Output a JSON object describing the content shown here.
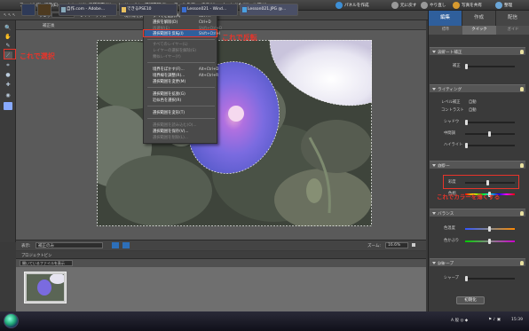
{
  "menubar": {
    "items": [
      "ファイル(F)",
      "編集(E)",
      "イメージ(I)",
      "画質調整(N)",
      "レイヤー(L)",
      "選択範囲(S)",
      "フィルタ(T)",
      "表示(V)",
      "ウィンドウ(W)",
      "ヘルプ(H)"
    ],
    "right_items": [
      "パネルを作成",
      "元に戻す",
      "やり直し",
      "写真を共有",
      "整理"
    ]
  },
  "options_bar": {
    "items": [
      "フェザー:",
      "レイヤーサイズ",
      "",
      "境界線を調整..."
    ]
  },
  "document": {
    "tab_title": "補正後"
  },
  "status": {
    "view_label": "表示:",
    "view_value": "補正のみ",
    "zoom_label": "ズーム:",
    "zoom_value": "16.6%"
  },
  "project_bin": {
    "header": "プロジェクトビン",
    "dropdown": "開いているファイルを表示"
  },
  "panel": {
    "tabs": [
      "編集",
      "作成",
      "配信"
    ],
    "subtabs": [
      "標準",
      "クイック",
      "ガイド"
    ],
    "sections": {
      "smart_fix": {
        "title": "スマート補正",
        "auto": "自動",
        "row": "補正"
      },
      "lighting": {
        "title": "ライティング",
        "rows": [
          "レベル補正",
          "コントラスト",
          "シャドウ",
          "中間調",
          "ハイライト"
        ],
        "autos": [
          "自動",
          "自動"
        ]
      },
      "color": {
        "title": "カラー",
        "auto": "自動",
        "rows": [
          "彩度",
          "色相"
        ]
      },
      "balance": {
        "title": "バランス",
        "rows": [
          "色温度",
          "色かぶり"
        ]
      },
      "sharpen": {
        "title": "シャープ",
        "auto": "自動",
        "row": "シャープ"
      }
    },
    "reset_button": "初期化"
  },
  "select_menu": {
    "items": [
      {
        "label": "すべてを選択(A)",
        "shortcut": "Ctrl+A",
        "enabled": true
      },
      {
        "label": "選択を解除(D)",
        "shortcut": "Ctrl+D",
        "enabled": true
      },
      {
        "label": "再選択(E)",
        "shortcut": "Shift+Ctrl+D",
        "enabled": false
      },
      {
        "label": "選択範囲を反転(I)",
        "shortcut": "Shift+Ctrl+I",
        "enabled": true,
        "highlight": true
      },
      {
        "label": "すべてのレイヤー(L)",
        "shortcut": "",
        "enabled": false
      },
      {
        "label": "レイヤーの選択を解除(S)",
        "shortcut": "",
        "enabled": false
      },
      {
        "label": "類似レイヤー(Y)",
        "shortcut": "",
        "enabled": false
      },
      {
        "label": "境界をぼかす(F)...",
        "shortcut": "Alt+Ctrl+D",
        "enabled": true
      },
      {
        "label": "境界線を調整(R)...",
        "shortcut": "Alt+Ctrl+R",
        "enabled": true
      },
      {
        "label": "選択範囲を変更(M)",
        "shortcut": "",
        "enabled": true
      },
      {
        "label": "選択範囲を拡張(G)",
        "shortcut": "",
        "enabled": true
      },
      {
        "label": "近似色を選択(R)",
        "shortcut": "",
        "enabled": true
      },
      {
        "label": "選択範囲を変形(T)",
        "shortcut": "",
        "enabled": true
      },
      {
        "label": "選択範囲を読み込む(O)...",
        "shortcut": "",
        "enabled": false
      },
      {
        "label": "選択範囲を保存(V)...",
        "shortcut": "",
        "enabled": true
      },
      {
        "label": "選択範囲を削除(L)...",
        "shortcut": "",
        "enabled": false
      }
    ]
  },
  "annotations": {
    "select_tool": "これで選択",
    "invert": "これで反転",
    "saturation": "これでカラーを薄くする"
  },
  "taskbar": {
    "items": [
      "自作.com - Adobe...",
      "できるPSE10",
      "Lesson021 - Wind...",
      "Lesson021.JPG @..."
    ],
    "clock": "15:39"
  },
  "colors": {
    "accent": "#2f5f9c",
    "annotation": "#e8342a"
  }
}
